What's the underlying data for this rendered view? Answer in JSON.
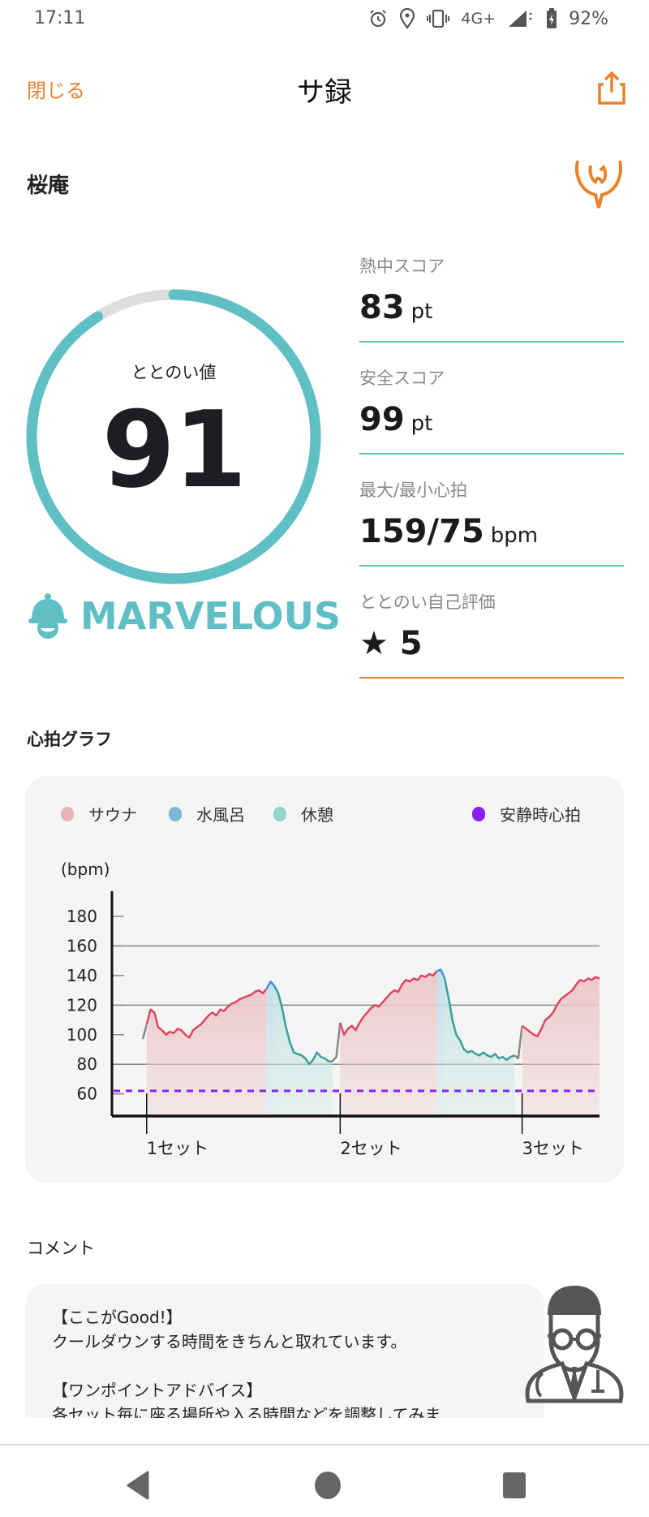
{
  "status_bar": {
    "time": "17:11",
    "network": "4G+",
    "battery": "92%",
    "icons": [
      "alarm-icon",
      "location-icon",
      "vibrate-icon",
      "signal-icon",
      "battery-charging-icon"
    ]
  },
  "header": {
    "close_label": "閉じる",
    "title": "サ録",
    "share_icon": "share-icon"
  },
  "facility": {
    "name": "桜庵",
    "logo_icon": "sauna-logo-icon"
  },
  "totonoi": {
    "label": "ととのい値",
    "value": "91",
    "progress": 0.91,
    "rank": "MARVELOUS",
    "rank_icon": "sauna-hat-icon"
  },
  "metrics": [
    {
      "label": "熱中スコア",
      "value": "83",
      "unit": "pt"
    },
    {
      "label": "安全スコア",
      "value": "99",
      "unit": "pt"
    },
    {
      "label": "最大/最小心拍",
      "value": "159/75",
      "unit": "bpm"
    },
    {
      "label": "ととのい自己評価",
      "value": "★ 5",
      "unit": ""
    }
  ],
  "colors": {
    "accent": "#e8822c",
    "teal": "#5fbfc5",
    "ring_track": "#dddddd"
  },
  "heart_section": {
    "title": "心拍グラフ"
  },
  "chart_data": {
    "type": "area",
    "ylabel": "(bpm)",
    "ylim": [
      45,
      197
    ],
    "yticks": [
      60,
      80,
      100,
      120,
      140,
      160,
      180
    ],
    "gridlines": [
      80,
      120,
      160
    ],
    "xtick_labels": [
      "1セット",
      "2セット",
      "3セット"
    ],
    "resting_hr": 62,
    "legend": [
      {
        "name": "サウナ",
        "color": "#e8b4b4"
      },
      {
        "name": "水風呂",
        "color": "#7ab8d6"
      },
      {
        "name": "休憩",
        "color": "#96d4cc"
      },
      {
        "name": "安静時心拍",
        "color": "#8a1ef0"
      }
    ],
    "phase_colors": {
      "pre": {
        "line": "#888888",
        "fill": "none"
      },
      "sauna": {
        "line": "#e0455f",
        "fill": "#ecc9cb"
      },
      "water": {
        "line": "#4a8fe0",
        "fill": "#c4e0ea"
      },
      "rest": {
        "line": "#3a9e9e",
        "fill": "#c9e6e2"
      }
    },
    "segments": [
      {
        "phase": "pre",
        "values": [
          97,
          107
        ]
      },
      {
        "phase": "sauna",
        "values": [
          107,
          117,
          115,
          105,
          103,
          100,
          102,
          101,
          104,
          103,
          100,
          98,
          103,
          105,
          107,
          110,
          113,
          115,
          113,
          117,
          116,
          119,
          121,
          122,
          124,
          125,
          126,
          127,
          129,
          130,
          128,
          131
        ]
      },
      {
        "phase": "water",
        "values": [
          131,
          136,
          133
        ]
      },
      {
        "phase": "rest",
        "values": [
          133,
          128,
          118,
          105,
          95,
          88,
          87,
          86,
          84,
          80,
          83,
          88,
          85,
          84,
          82,
          82
        ]
      },
      {
        "phase": "pre",
        "values": [
          82,
          85,
          108
        ]
      },
      {
        "phase": "sauna",
        "values": [
          108,
          100,
          104,
          106,
          103,
          108,
          112,
          115,
          118,
          120,
          119,
          122,
          125,
          128,
          130,
          129,
          134,
          137,
          136,
          138,
          137,
          140,
          139,
          141,
          140,
          143
        ]
      },
      {
        "phase": "water",
        "values": [
          143,
          144,
          138
        ]
      },
      {
        "phase": "rest",
        "values": [
          138,
          125,
          110,
          100,
          96,
          90,
          88,
          89,
          87,
          86,
          88,
          86,
          85,
          87,
          84,
          85,
          83,
          85,
          86
        ]
      },
      {
        "phase": "pre",
        "values": [
          86,
          84,
          106
        ]
      },
      {
        "phase": "sauna",
        "values": [
          106,
          104,
          102,
          100,
          99,
          104,
          110,
          112,
          115,
          120,
          124,
          126,
          128,
          130,
          134,
          137,
          136,
          138,
          137,
          139,
          138
        ]
      }
    ]
  },
  "comment": {
    "title": "コメント",
    "text": "【ここがGood!】\nクールダウンする時間をきちんと取れています。\n\n【ワンポイントアドバイス】\n各セット毎に座る場所や入る時間などを調整してみま",
    "avatar_icon": "doctor-avatar-icon"
  },
  "nav": {
    "back": "back-icon",
    "home": "home-icon",
    "recents": "recents-icon"
  }
}
